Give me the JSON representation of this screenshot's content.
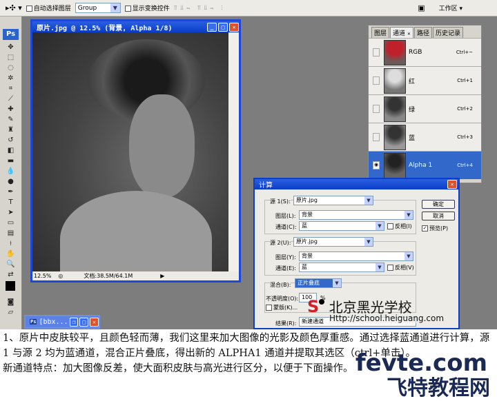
{
  "toolbar": {
    "auto_select_label": "自动选择图层",
    "auto_select_value": "Group",
    "show_transform_label": "显示变换控件",
    "workspace_label": "工作区 ▾"
  },
  "tools_panel": {
    "badge": "Ps"
  },
  "document": {
    "title": "原片.jpg @ 12.5% (背景, Alpha 1/8)",
    "zoom": "12.5%",
    "doc_size": "文档:38.5M/64.1M"
  },
  "minimized_doc": {
    "title": "[bbx..."
  },
  "channels_panel": {
    "tabs": [
      "图层",
      "通道",
      "路径",
      "历史记录"
    ],
    "active_tab": "通道",
    "channels": [
      {
        "name": "RGB",
        "shortcut": "Ctrl+~"
      },
      {
        "name": "红",
        "shortcut": "Ctrl+1"
      },
      {
        "name": "绿",
        "shortcut": "Ctrl+2"
      },
      {
        "name": "蓝",
        "shortcut": "Ctrl+3"
      },
      {
        "name": "Alpha 1",
        "shortcut": "Ctrl+4",
        "selected": true
      }
    ]
  },
  "calc_dialog": {
    "title": "计算",
    "source1_label": "源 1(S):",
    "source1_value": "原片.jpg",
    "layer1_label": "图层(L):",
    "layer1_value": "背景",
    "channel1_label": "通道(C):",
    "channel1_value": "蓝",
    "invert1_label": "反相(I)",
    "source2_label": "源 2(U):",
    "source2_value": "原片.jpg",
    "layer2_label": "图层(Y):",
    "layer2_value": "背景",
    "channel2_label": "通道(E):",
    "channel2_value": "蓝",
    "invert2_label": "反相(V)",
    "blend_label": "混合(B):",
    "blend_value": "正片叠底",
    "opacity_label": "不透明度(O):",
    "opacity_value": "100",
    "opacity_unit": "%",
    "mask_label": "蒙版(K)...",
    "result_label": "结果(R):",
    "result_value": "新建通道",
    "ok": "确定",
    "cancel": "取消",
    "preview_label": "预览(P)",
    "preview_checked": true
  },
  "watermark": {
    "school": "北京黑光学校",
    "url": "Http://school.heiguang.com",
    "site": "fevte.com",
    "site_cn": "飞特教程网"
  },
  "caption": {
    "line1": "1、原片中皮肤较平，且颜色轻而薄，我们这里来加大图像的光影及颜色厚重感。通过选择蓝通道进行计算，源 1 与源 2 均为蓝通道，混合正片叠底，得出新的 ALPHA1 通道并提取其选区（ctrl+单击）。",
    "line2": "新通道特点：加大图像反差，使大面积皮肤与高光进行区分，以便于下面操作。"
  },
  "colors": {
    "title_blue": "#0a3dc8",
    "selection_blue": "#3168c9",
    "workspace_gray": "#7d7d7d"
  }
}
